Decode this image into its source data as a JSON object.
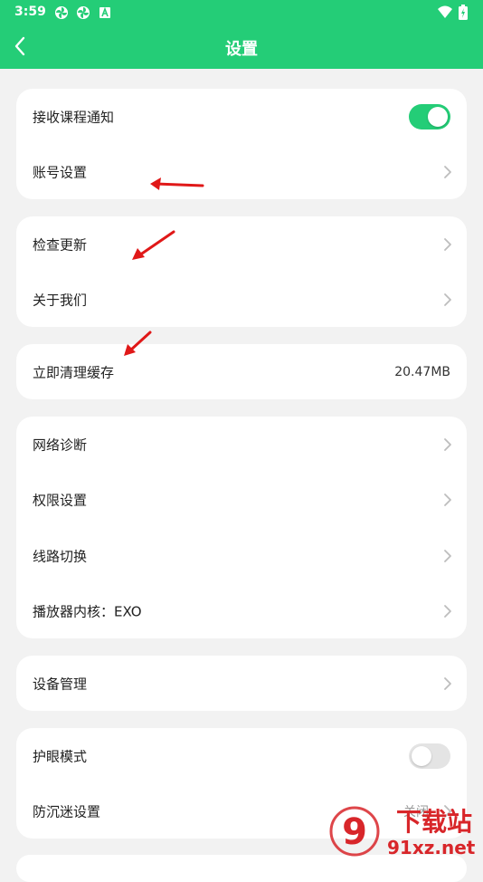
{
  "status_bar": {
    "time": "3:59",
    "icons": [
      "pinwheel-icon",
      "pinwheel-icon",
      "a-badge-icon",
      "wifi-icon",
      "battery-icon"
    ]
  },
  "header": {
    "title": "设置",
    "accent_color": "#24cd77"
  },
  "groups": [
    {
      "items": [
        {
          "label": "接收课程通知",
          "control": "toggle",
          "on": true
        },
        {
          "label": "账号设置",
          "control": "chevron"
        }
      ]
    },
    {
      "items": [
        {
          "label": "检查更新",
          "control": "chevron"
        },
        {
          "label": "关于我们",
          "control": "chevron"
        }
      ]
    },
    {
      "items": [
        {
          "label": "立即清理缓存",
          "control": "value",
          "value": "20.47MB"
        }
      ]
    },
    {
      "items": [
        {
          "label": "网络诊断",
          "control": "chevron"
        },
        {
          "label": "权限设置",
          "control": "chevron"
        },
        {
          "label": "线路切换",
          "control": "chevron"
        },
        {
          "label": "播放器内核：EXO",
          "control": "chevron"
        }
      ]
    },
    {
      "items": [
        {
          "label": "设备管理",
          "control": "chevron"
        }
      ]
    },
    {
      "items": [
        {
          "label": "护眼模式",
          "control": "toggle",
          "on": false
        },
        {
          "label": "防沉迷设置",
          "control": "value",
          "value": "关闭"
        }
      ]
    }
  ],
  "annotations": {
    "arrow_color": "#e01818",
    "count": 3
  },
  "watermark": {
    "logo_text": "9",
    "title": "下载站",
    "url": "91xz.net",
    "color": "#d8262a"
  }
}
